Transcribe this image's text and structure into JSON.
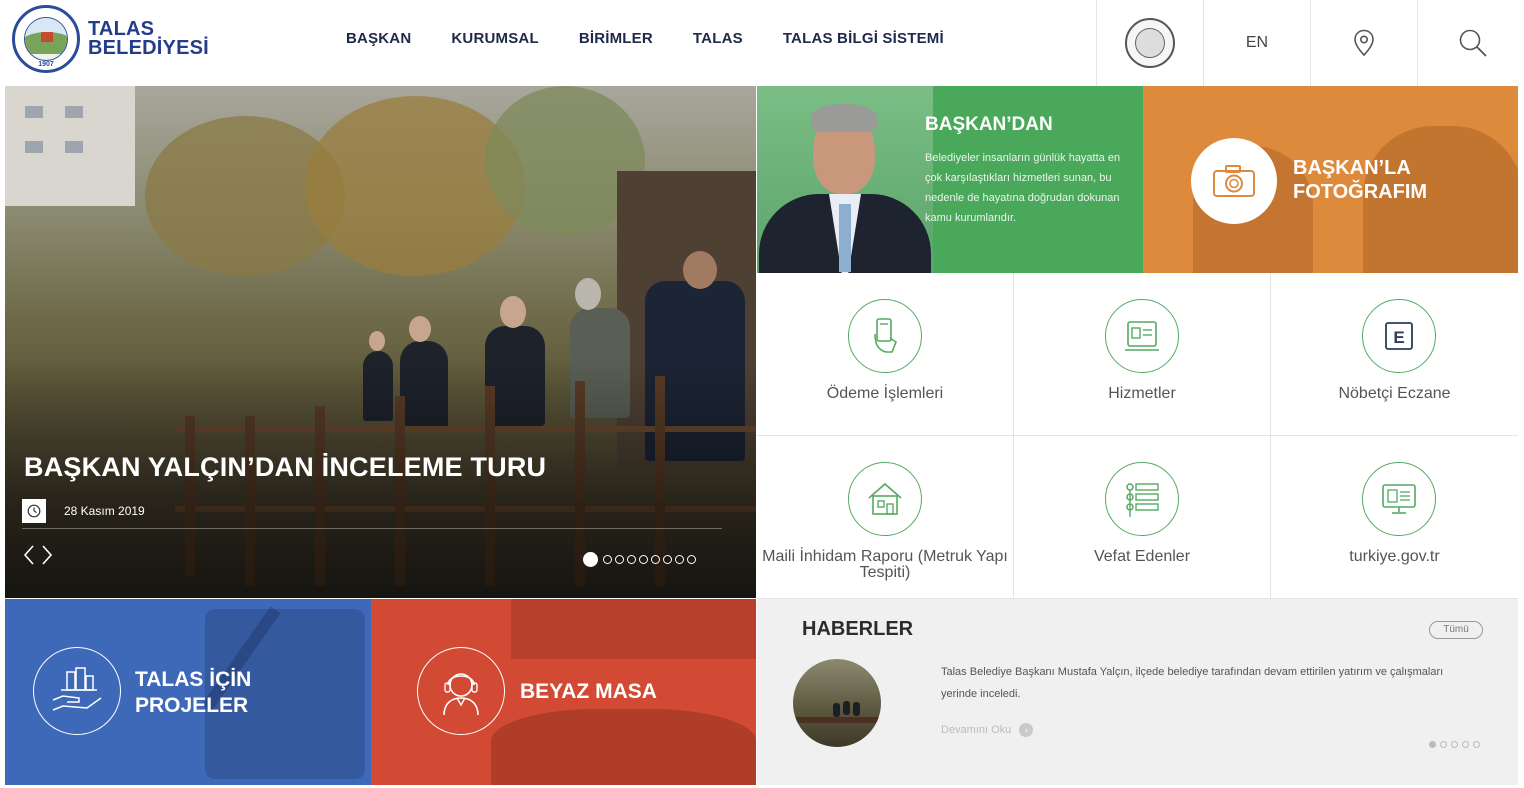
{
  "header": {
    "logo_line1": "TALAS",
    "logo_line2": "BELEDİYESİ",
    "logo_seal_year": "1907",
    "nav": [
      {
        "label": "BAŞKAN"
      },
      {
        "label": "KURUMSAL"
      },
      {
        "label": "BİRİMLER"
      },
      {
        "label": "TALAS"
      },
      {
        "label": "TALAS BİLGİ SİSTEMİ"
      }
    ],
    "lang": "EN",
    "icons": [
      "seal-icon",
      "location-pin-icon",
      "search-icon"
    ]
  },
  "slider": {
    "title": "BAŞKAN YALÇIN’DAN İNCELEME TURU",
    "date": "28 Kasım 2019",
    "prev": "‹",
    "next": "›",
    "slide_count": 9,
    "active_slide": 1
  },
  "baskan": {
    "title": "BAŞKAN’DAN",
    "text": "Belediyeler insanların günlük hayatta en çok karşılaştıkları hizmetleri sunan, bu nedenle de hayatına doğrudan dokunan kamu kurumlarıdır."
  },
  "foto": {
    "title_line1": "BAŞKAN’LA",
    "title_line2": "FOTOĞRAFIM"
  },
  "quick_links": [
    {
      "label": "Ödeme İşlemleri",
      "icon": "payment-card-icon"
    },
    {
      "label": "Hizmetler",
      "icon": "services-icon"
    },
    {
      "label": "Nöbetçi Eczane",
      "icon": "pharmacy-icon"
    },
    {
      "label": "Maili İnhidam Raporu (Metruk Yapı Tespiti)",
      "icon": "house-icon"
    },
    {
      "label": "Vefat Edenler",
      "icon": "list-icon"
    },
    {
      "label": "turkiye.gov.tr",
      "icon": "computer-icon"
    }
  ],
  "tiles": {
    "projects_line1": "TALAS İÇİN",
    "projects_line2": "PROJELER",
    "beyaz": "BEYAZ MASA"
  },
  "news": {
    "title": "HABERLER",
    "all": "Tümü",
    "text": "Talas Belediye Başkanı Mustafa Yalçın, ilçede belediye tarafından devam ettirilen yatırım ve çalışmaları yerinde inceledi.",
    "read_more": "Devamını Oku",
    "dot_count": 5,
    "active_dot": 1
  },
  "colors": {
    "brand_blue": "#233d8c",
    "green": "#4aa85b",
    "orange": "#de8a3d",
    "blue_tile": "#3e69b8",
    "red_tile": "#d24a34",
    "icon_green": "#54aa62"
  }
}
